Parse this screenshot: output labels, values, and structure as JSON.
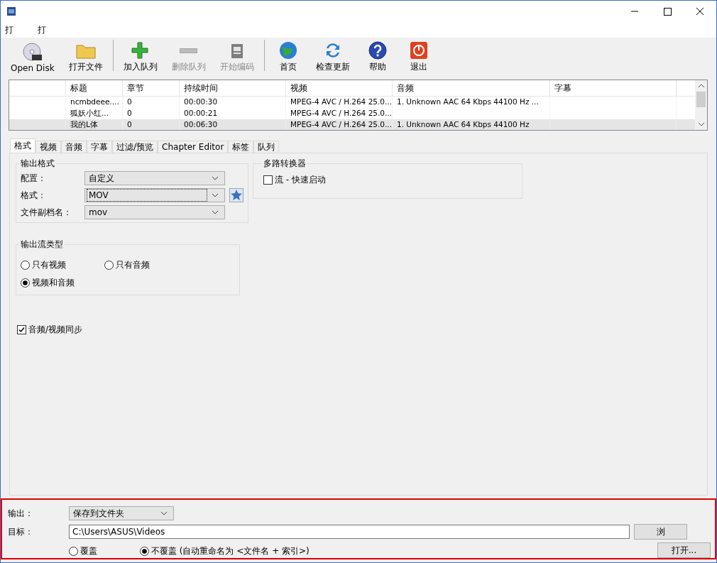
{
  "menu": [
    "打",
    "打"
  ],
  "toolbar": [
    {
      "label": "Open Disk",
      "disabled": false
    },
    {
      "label": "打开文件",
      "disabled": false
    },
    {
      "label": "加入队列",
      "disabled": false
    },
    {
      "label": "删除队列",
      "disabled": true
    },
    {
      "label": "开始编码",
      "disabled": true
    },
    {
      "label": "首页",
      "disabled": false
    },
    {
      "label": "检查更新",
      "disabled": false
    },
    {
      "label": "帮助",
      "disabled": false
    },
    {
      "label": "退出",
      "disabled": false
    }
  ],
  "table": {
    "columns": [
      "标题",
      "章节",
      "持续时间",
      "视频",
      "音频",
      "字幕"
    ],
    "rows": [
      {
        "selected": false,
        "cells": [
          "ncmbdeee....",
          "0",
          "00:00:30",
          "MPEG-4 AVC / H.264 25.0...",
          "1. Unknown AAC  64 Kbps 44100 Hz ...",
          ""
        ]
      },
      {
        "selected": false,
        "cells": [
          "狐妖小红...",
          "0",
          "00:00:21",
          "MPEG-4 AVC / H.264 25.0...",
          "",
          ""
        ]
      },
      {
        "selected": true,
        "cells": [
          "我的L体",
          "0",
          "00:06:30",
          "MPEG-4 AVC / H.264 25.0...",
          "1. Unknown AAC  64 Kbps 44100 Hz",
          ""
        ]
      }
    ]
  },
  "tabs": [
    {
      "label": "格式",
      "selected": true
    },
    {
      "label": "视频",
      "selected": false
    },
    {
      "label": "音频",
      "selected": false
    },
    {
      "label": "字幕",
      "selected": false
    },
    {
      "label": "过滤/预览",
      "selected": false
    },
    {
      "label": "Chapter Editor",
      "selected": false
    },
    {
      "label": "标签",
      "selected": false
    },
    {
      "label": "队列",
      "selected": false
    }
  ],
  "output_format": {
    "title": "输出格式",
    "fields": [
      {
        "label": "配置：",
        "value": "自定义",
        "focused": false
      },
      {
        "label": "格式：",
        "value": "MOV",
        "focused": true
      },
      {
        "label": "文件副档名：",
        "value": "mov",
        "focused": false
      }
    ]
  },
  "muxer": {
    "title": "多路转换器",
    "checkbox": {
      "label": "流 - 快速启动",
      "checked": false
    }
  },
  "stream_type": {
    "title": "输出流类型",
    "options": [
      {
        "label": "只有视频",
        "selected": false
      },
      {
        "label": "只有音频",
        "selected": false
      },
      {
        "label": "视频和音频",
        "selected": true
      }
    ]
  },
  "av_sync": {
    "label": "音频/视频同步",
    "checked": true
  },
  "bottom": {
    "output_label": "输出：",
    "output_value": "保存到文件夹",
    "target_label": "目标：",
    "target_value": "C:\\Users\\ASUS\\Videos",
    "browse_button": "浏",
    "open_button": "打开...",
    "overwrite": [
      {
        "label": "覆盖",
        "selected": false
      },
      {
        "label": "不覆盖 (自动重命名为 <文件名 + 索引>)",
        "selected": true
      }
    ]
  }
}
